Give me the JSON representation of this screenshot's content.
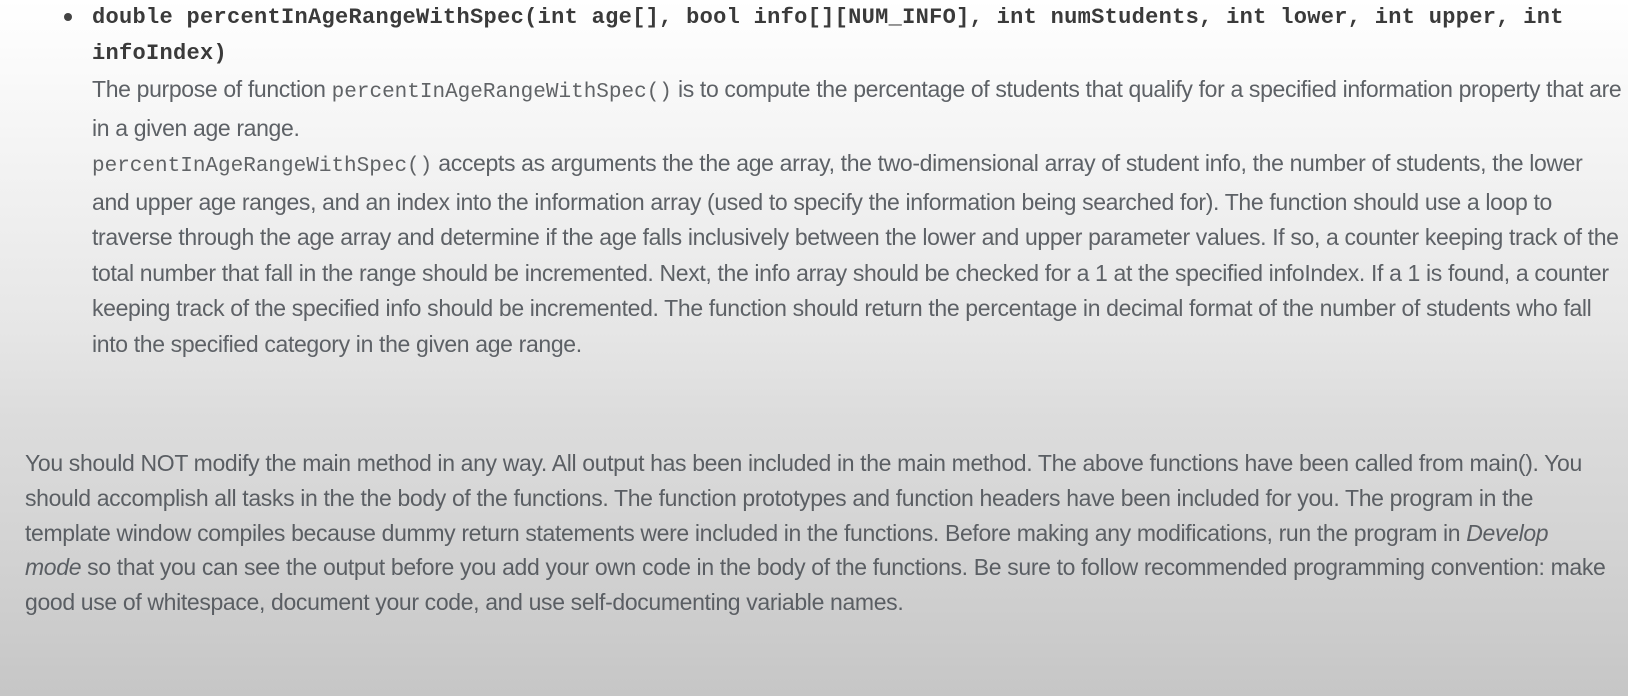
{
  "function_item": {
    "signature": "double percentInAgeRangeWithSpec(int age[], bool info[][NUM_INFO], int numStudents, int lower, int upper, int infoIndex)",
    "purpose": {
      "prefix": "The purpose of function ",
      "code": "percentInAgeRangeWithSpec()",
      "suffix": " is to compute the percentage of students that qualify for a specified information property that are in a given age range."
    },
    "description": {
      "code": "percentInAgeRangeWithSpec()",
      "text": " accepts as arguments the the age array, the two-dimensional array of student info, the number of students, the lower and upper age ranges, and an index into the information array (used to specify the information being searched for). The function should use a loop to traverse through the age array and determine if the age falls inclusively between the lower and upper parameter values. If so, a counter keeping track of the total number that fall in the range should be incremented. Next, the info array should be checked for a 1 at the specified infoIndex. If a 1 is found, a counter keeping track of the specified info should be incremented. The function should return the percentage in decimal format of the number of students who fall into the specified category in the given age range."
    }
  },
  "instructions": {
    "part1": "You should NOT modify the main method in any way. All output has been included in the main method. The above functions have been called from main(). You should accomplish all tasks in the the body of the functions. The function prototypes and function headers have been included for you. The program in the template window compiles because dummy return statements were included in the functions. Before making any modifications, run the program in ",
    "emphasis": "Develop mode",
    "part2": " so that you can see the output before you add your own code in the body of the functions. Be sure to follow recommended programming convention: make good use of whitespace, document your code, and use self-documenting variable names."
  }
}
